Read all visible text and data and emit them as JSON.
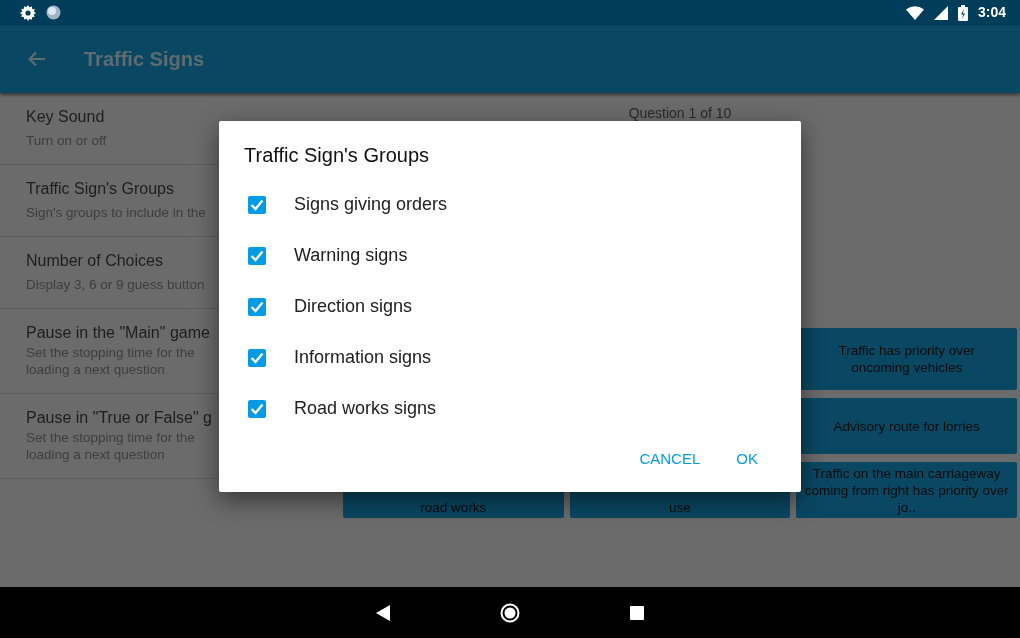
{
  "status_bar": {
    "time": "3:04"
  },
  "app_bar": {
    "title": "Traffic Signs"
  },
  "settings": [
    {
      "title": "Key Sound",
      "summary": [
        "Turn on or off"
      ]
    },
    {
      "title": "Traffic Sign's Groups",
      "summary": [
        "Sign's groups to include in the"
      ]
    },
    {
      "title": "Number of Choices",
      "summary": [
        "Display 3, 6 or 9 guess button"
      ]
    },
    {
      "title": "Pause in the \"Main\" game",
      "summary": [
        "Set the stopping time for the",
        "loading a next question"
      ]
    },
    {
      "title": "Pause in \"True or False\" g",
      "summary": [
        "Set the stopping time for the",
        "loading a next question"
      ]
    }
  ],
  "quiz": {
    "question_counter": "Question 1 of 10",
    "answers": [
      {
        "text": "Traffic has priority over oncoming vehicles"
      },
      {
        "text": "Advisory route for lorries"
      },
      {
        "text": "road works"
      },
      {
        "text": "use"
      },
      {
        "text": "Traffic on the main carriageway coming from right has priority over jo.."
      }
    ]
  },
  "dialog": {
    "title": "Traffic Sign's Groups",
    "options": [
      {
        "label": "Signs giving orders",
        "checked": true
      },
      {
        "label": "Warning signs",
        "checked": true
      },
      {
        "label": "Direction signs",
        "checked": true
      },
      {
        "label": "Information signs",
        "checked": true
      },
      {
        "label": "Road works signs",
        "checked": true
      }
    ],
    "buttons": [
      "CANCEL",
      "OK"
    ]
  }
}
